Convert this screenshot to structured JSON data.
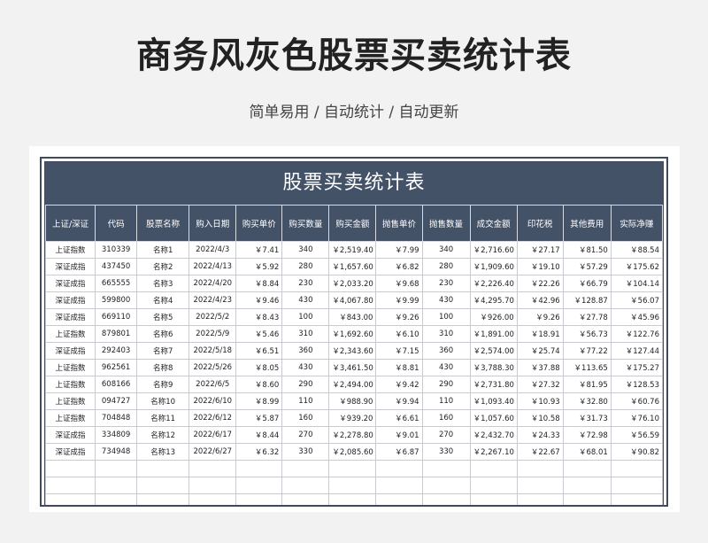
{
  "page": {
    "title": "商务风灰色股票买卖统计表",
    "subtitle": "简单易用  /  自动统计  /  自动更新"
  },
  "sheet": {
    "banner": "股票买卖统计表",
    "headers": [
      "上证/深证",
      "代码",
      "股票名称",
      "购入日期",
      "购买单价",
      "购买数量",
      "购买金额",
      "抛售单价",
      "抛售数量",
      "成交金额",
      "印花税",
      "其他费用",
      "实际净赚"
    ],
    "rows": [
      [
        "上证指数",
        "310339",
        "名称1",
        "2022/4/3",
        "￥7.41",
        "340",
        "￥2,519.40",
        "￥7.99",
        "340",
        "￥2,716.60",
        "￥27.17",
        "￥81.50",
        "￥88.54"
      ],
      [
        "深证成指",
        "437450",
        "名称2",
        "2022/4/13",
        "￥5.92",
        "280",
        "￥1,657.60",
        "￥6.82",
        "280",
        "￥1,909.60",
        "￥19.10",
        "￥57.29",
        "￥175.62"
      ],
      [
        "深证成指",
        "665555",
        "名称3",
        "2022/4/20",
        "￥8.84",
        "230",
        "￥2,033.20",
        "￥9.68",
        "230",
        "￥2,226.40",
        "￥22.26",
        "￥66.79",
        "￥104.14"
      ],
      [
        "深证成指",
        "599800",
        "名称4",
        "2022/4/23",
        "￥9.46",
        "430",
        "￥4,067.80",
        "￥9.99",
        "430",
        "￥4,295.70",
        "￥42.96",
        "￥128.87",
        "￥56.07"
      ],
      [
        "深证成指",
        "669110",
        "名称5",
        "2022/5/2",
        "￥8.43",
        "100",
        "￥843.00",
        "￥9.26",
        "100",
        "￥926.00",
        "￥9.26",
        "￥27.78",
        "￥45.96"
      ],
      [
        "上证指数",
        "879801",
        "名称6",
        "2022/5/9",
        "￥5.46",
        "310",
        "￥1,692.60",
        "￥6.10",
        "310",
        "￥1,891.00",
        "￥18.91",
        "￥56.73",
        "￥122.76"
      ],
      [
        "深证成指",
        "292403",
        "名称7",
        "2022/5/18",
        "￥6.51",
        "360",
        "￥2,343.60",
        "￥7.15",
        "360",
        "￥2,574.00",
        "￥25.74",
        "￥77.22",
        "￥127.44"
      ],
      [
        "上证指数",
        "962561",
        "名称8",
        "2022/5/26",
        "￥8.05",
        "430",
        "￥3,461.50",
        "￥8.81",
        "430",
        "￥3,788.30",
        "￥37.88",
        "￥113.65",
        "￥175.27"
      ],
      [
        "上证指数",
        "608166",
        "名称9",
        "2022/6/5",
        "￥8.60",
        "290",
        "￥2,494.00",
        "￥9.42",
        "290",
        "￥2,731.80",
        "￥27.32",
        "￥81.95",
        "￥128.53"
      ],
      [
        "上证指数",
        "094727",
        "名称10",
        "2022/6/10",
        "￥8.99",
        "110",
        "￥988.90",
        "￥9.94",
        "110",
        "￥1,093.40",
        "￥10.93",
        "￥32.80",
        "￥60.76"
      ],
      [
        "上证指数",
        "704848",
        "名称11",
        "2022/6/12",
        "￥5.87",
        "160",
        "￥939.20",
        "￥6.61",
        "160",
        "￥1,057.60",
        "￥10.58",
        "￥31.73",
        "￥76.10"
      ],
      [
        "深证成指",
        "334809",
        "名称12",
        "2022/6/17",
        "￥8.44",
        "270",
        "￥2,278.80",
        "￥9.01",
        "270",
        "￥2,432.70",
        "￥24.33",
        "￥72.98",
        "￥56.59"
      ],
      [
        "深证成指",
        "734948",
        "名称13",
        "2022/6/27",
        "￥6.32",
        "330",
        "￥2,085.60",
        "￥6.87",
        "330",
        "￥2,267.10",
        "￥22.67",
        "￥68.01",
        "￥90.82"
      ]
    ],
    "empty_rows": 3
  }
}
